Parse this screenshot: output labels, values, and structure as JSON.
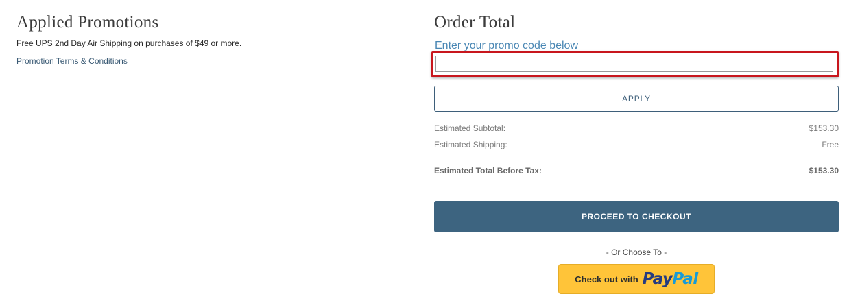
{
  "promotions": {
    "title": "Applied Promotions",
    "description": "Free UPS 2nd Day Air Shipping on purchases of $49 or more.",
    "terms_link": "Promotion Terms & Conditions"
  },
  "order": {
    "title": "Order Total",
    "promo_label": "Enter your promo code below",
    "promo_value": "",
    "apply_label": "APPLY",
    "subtotal_label": "Estimated Subtotal:",
    "subtotal_value": "$153.30",
    "shipping_label": "Estimated Shipping:",
    "shipping_value": "Free",
    "total_label": "Estimated Total Before Tax:",
    "total_value": "$153.30",
    "checkout_label": "PROCEED TO CHECKOUT",
    "or_choose": "- Or Choose To -",
    "paypal": {
      "prefix": "Check out with",
      "logo_pay": "Pay",
      "logo_pal": "Pal"
    }
  },
  "colors": {
    "accent": "#3d6480",
    "link": "#4a87b4",
    "highlight": "#c8161d",
    "paypal_yellow": "#ffc439",
    "paypal_dark_blue": "#253b80",
    "paypal_light_blue": "#179bd7"
  }
}
